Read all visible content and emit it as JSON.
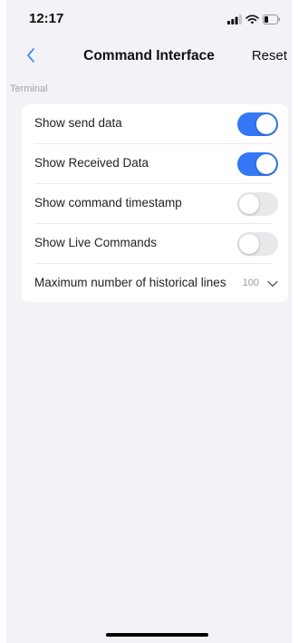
{
  "status_bar": {
    "time": "12:17",
    "icons": [
      "signal-icon",
      "wifi-icon",
      "battery-icon"
    ]
  },
  "nav": {
    "back_icon": "chevron-left-icon",
    "title": "Command Interface",
    "reset_label": "Reset"
  },
  "section": {
    "title": "Terminal"
  },
  "settings": {
    "show_send_data": {
      "label": "Show send data",
      "enabled": true
    },
    "show_received_data": {
      "label": "Show Received Data",
      "enabled": true
    },
    "show_command_timestamp": {
      "label": "Show command timestamp",
      "enabled": false
    },
    "show_live_commands": {
      "label": "Show Live Commands",
      "enabled": false
    },
    "max_history_lines": {
      "label": "Maximum number of historical lines",
      "value": "100",
      "icon": "chevron-down-icon"
    }
  },
  "colors": {
    "accent": "#3478f6",
    "background": "#f2f2f7",
    "card": "#ffffff",
    "toggle_off": "#e9e9eb",
    "back_icon": "#3478f6"
  }
}
